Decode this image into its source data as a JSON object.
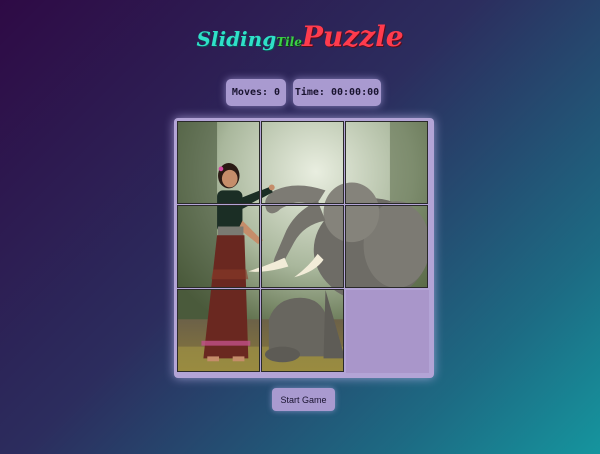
{
  "title": {
    "sliding": "Sliding",
    "tile": "Tile",
    "puzzle": "Puzzle"
  },
  "stats": {
    "moves": "Moves: 0",
    "time": "Time: 00:00:00"
  },
  "board": {
    "grid_size": 3,
    "empty_tile": 9,
    "image": "woman-and-elephant-photo"
  },
  "start_button": "Start Game",
  "colors": {
    "sliding": "#2fe0c8",
    "tile": "#3bd046",
    "puzzle": "#ff3b4d",
    "panel": "#a99ad0"
  }
}
